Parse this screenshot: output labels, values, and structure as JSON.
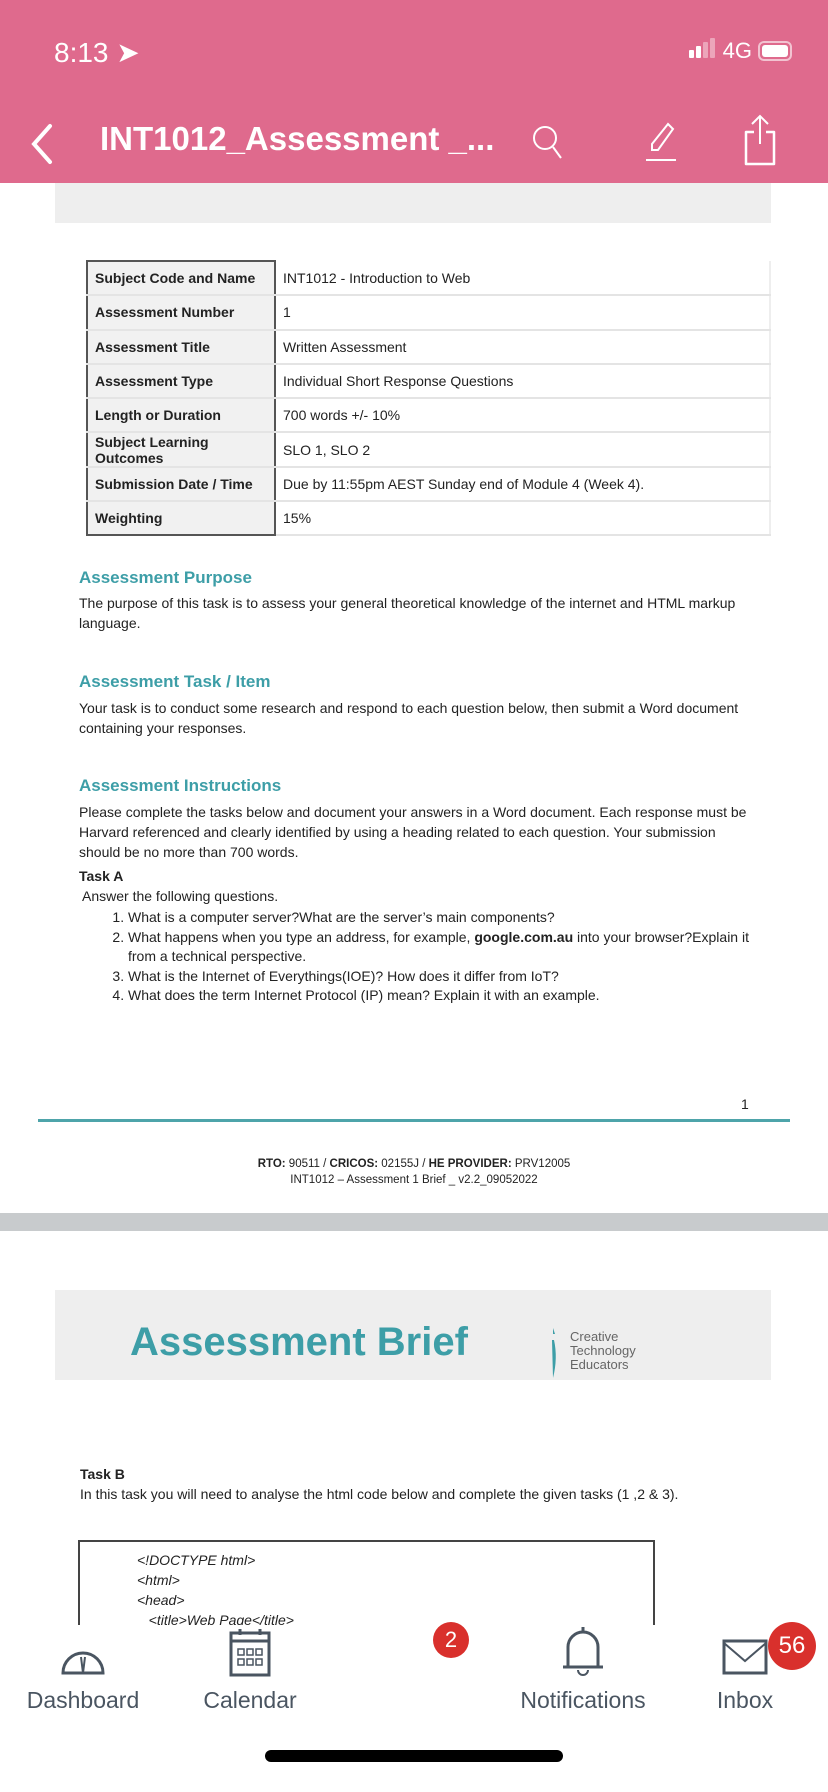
{
  "status_bar": {
    "time": "8:13",
    "network": "4G"
  },
  "nav": {
    "title": "INT1012_Assessment _..."
  },
  "table": [
    {
      "label": "Subject Code and Name",
      "value": "INT1012 - Introduction to Web"
    },
    {
      "label": "Assessment Number",
      "value": "1"
    },
    {
      "label": "Assessment Title",
      "value": "Written Assessment"
    },
    {
      "label": "Assessment Type",
      "value": "Individual Short Response Questions"
    },
    {
      "label": "Length or Duration",
      "value": "700 words +/- 10%"
    },
    {
      "label": "Subject Learning Outcomes",
      "value": "SLO 1, SLO 2"
    },
    {
      "label": "Submission Date / Time",
      "value": "Due by 11:55pm AEST Sunday end of Module 4 (Week 4)."
    },
    {
      "label": "Weighting",
      "value": "15%"
    }
  ],
  "purpose": {
    "heading": "Assessment Purpose",
    "text": "The purpose of this task is to assess your general theoretical knowledge of the internet and HTML markup language."
  },
  "task_item": {
    "heading": "Assessment Task / Item",
    "text": "Your task is to conduct some research and respond to each question below, then submit a Word document containing your responses."
  },
  "instructions": {
    "heading": "Assessment Instructions",
    "text": "Please complete the tasks below and document your answers in a Word document. Each response must be Harvard referenced and clearly identified by using a heading related to each question. Your submission should be no more than 700 words."
  },
  "task_a": {
    "heading": "Task A",
    "intro": "Answer the following questions.",
    "q1": "What is a computer server?What are the server’s main components?",
    "q2_pre": "What happens when you type an address, for example, ",
    "q2_bold": "google.com.au",
    "q2_post": " into your browser?Explain it from a technical perspective.",
    "q3": "What is the Internet of Everythings(IOE)? How does it differ from IoT?",
    "q4": "What does the term Internet Protocol (IP) mean? Explain it with an example."
  },
  "footer": {
    "page": "1",
    "line1_rto_label": "RTO:",
    "line1_rto": " 90511 / ",
    "line1_cricos_label": "CRICOS:",
    "line1_cricos": " 02155J / ",
    "line1_he_label": "HE PROVIDER:",
    "line1_he": " PRV12005",
    "line2": "INT1012 – Assessment 1 Brief _ v2.2_09052022"
  },
  "banner": {
    "title": "Assessment Brief",
    "logo_line1": "Creative",
    "logo_line2": "Technology",
    "logo_line3": "Educators"
  },
  "task_b": {
    "heading": "Task B",
    "text": "In this task you will need to analyse the html code below and complete the given tasks (1 ,2 & 3).",
    "code": [
      "<!DOCTYPE html>",
      "<html>",
      "<head>",
      "   <title>Web Page</title>"
    ]
  },
  "tabs": [
    {
      "label": "Dashboard"
    },
    {
      "label": "Calendar"
    },
    {
      "label": "Notifications",
      "badge": "2"
    },
    {
      "label": "Inbox",
      "badge": "56"
    }
  ],
  "colors": {
    "header": "#df6a8d",
    "accent": "#3d9ea7",
    "badge": "#d9302c"
  }
}
